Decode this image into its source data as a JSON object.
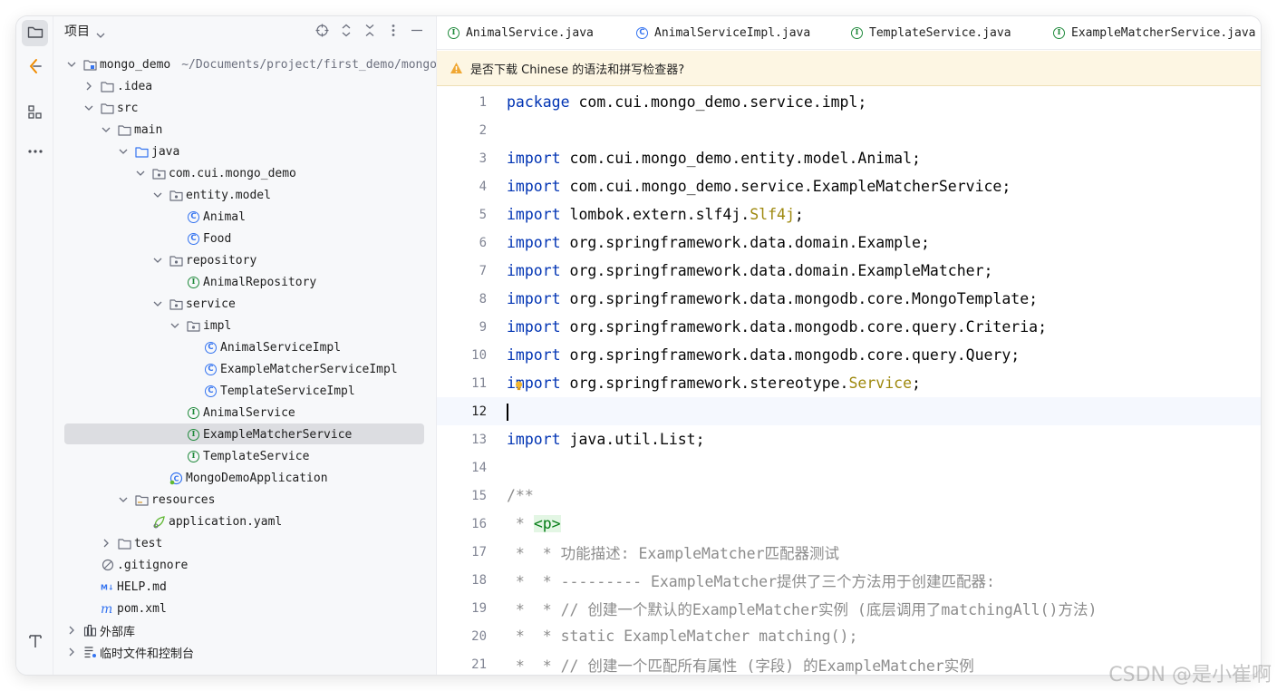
{
  "project_panel": {
    "title": "项目",
    "tree": [
      {
        "label": "mongo_demo",
        "path": "~/Documents/project/first_demo/mongo",
        "icon": "module-folder-icon",
        "expanded": true,
        "depth": 0
      },
      {
        "label": ".idea",
        "icon": "folder-icon",
        "expanded": false,
        "depth": 1
      },
      {
        "label": "src",
        "icon": "folder-icon",
        "expanded": true,
        "depth": 1
      },
      {
        "label": "main",
        "icon": "folder-icon",
        "expanded": true,
        "depth": 2
      },
      {
        "label": "java",
        "icon": "source-folder-icon",
        "expanded": true,
        "depth": 3
      },
      {
        "label": "com.cui.mongo_demo",
        "icon": "package-icon",
        "expanded": true,
        "depth": 4
      },
      {
        "label": "entity.model",
        "icon": "package-icon",
        "expanded": true,
        "depth": 5
      },
      {
        "label": "Animal",
        "icon": "class-icon",
        "depth": 6
      },
      {
        "label": "Food",
        "icon": "class-icon",
        "depth": 6
      },
      {
        "label": "repository",
        "icon": "package-icon",
        "expanded": true,
        "depth": 5
      },
      {
        "label": "AnimalRepository",
        "icon": "interface-icon",
        "depth": 6
      },
      {
        "label": "service",
        "icon": "package-icon",
        "expanded": true,
        "depth": 5
      },
      {
        "label": "impl",
        "icon": "package-icon",
        "expanded": true,
        "depth": 6
      },
      {
        "label": "AnimalServiceImpl",
        "icon": "class-icon",
        "depth": 7
      },
      {
        "label": "ExampleMatcherServiceImpl",
        "icon": "class-icon",
        "depth": 7
      },
      {
        "label": "TemplateServiceImpl",
        "icon": "class-icon",
        "depth": 7
      },
      {
        "label": "AnimalService",
        "icon": "interface-icon",
        "depth": 6
      },
      {
        "label": "ExampleMatcherService",
        "icon": "interface-icon",
        "depth": 6,
        "selected": true
      },
      {
        "label": "TemplateService",
        "icon": "interface-icon",
        "depth": 6
      },
      {
        "label": "MongoDemoApplication",
        "icon": "spring-app-icon",
        "depth": 5
      },
      {
        "label": "resources",
        "icon": "resources-folder-icon",
        "expanded": true,
        "depth": 3
      },
      {
        "label": "application.yaml",
        "icon": "yaml-icon",
        "depth": 4
      },
      {
        "label": "test",
        "icon": "folder-icon",
        "expanded": false,
        "depth": 2
      },
      {
        "label": ".gitignore",
        "icon": "ignore-icon",
        "depth": 1
      },
      {
        "label": "HELP.md",
        "icon": "markdown-icon",
        "depth": 1
      },
      {
        "label": "pom.xml",
        "icon": "maven-icon",
        "depth": 1
      },
      {
        "label": "外部库",
        "icon": "library-icon",
        "expanded": false,
        "depth": 0
      },
      {
        "label": "临时文件和控制台",
        "icon": "scratch-icon",
        "expanded": false,
        "depth": 0
      }
    ]
  },
  "tabs": [
    {
      "label": "AnimalService.java",
      "icon": "interface-icon"
    },
    {
      "label": "AnimalServiceImpl.java",
      "icon": "class-icon"
    },
    {
      "label": "TemplateService.java",
      "icon": "interface-icon"
    },
    {
      "label": "ExampleMatcherService.java",
      "icon": "interface-icon"
    }
  ],
  "banner": {
    "text": "是否下载 Chinese 的语法和拼写检查器?"
  },
  "code_lines": [
    "package com.cui.mongo_demo.service.impl;",
    "",
    "import com.cui.mongo_demo.entity.model.Animal;",
    "import com.cui.mongo_demo.service.ExampleMatcherService;",
    "import lombok.extern.slf4j.Slf4j;",
    "import org.springframework.data.domain.Example;",
    "import org.springframework.data.domain.ExampleMatcher;",
    "import org.springframework.data.mongodb.core.MongoTemplate;",
    "import org.springframework.data.mongodb.core.query.Criteria;",
    "import org.springframework.data.mongodb.core.query.Query;",
    "import org.springframework.stereotype.Service;",
    "",
    "import java.util.List;",
    "",
    "/**",
    " * <p>",
    " *  * 功能描述: ExampleMatcher匹配器测试",
    " *  * --------- ExampleMatcher提供了三个方法用于创建匹配器:",
    " *  * // 创建一个默认的ExampleMatcher实例 (底层调用了matchingAll()方法)",
    " *  * static ExampleMatcher matching();",
    " *  * // 创建一个匹配所有属性 (字段) 的ExampleMatcher实例"
  ],
  "current_line": 12,
  "watermark": "CSDN @是小崔啊",
  "colors": {
    "keyword": "#0033b3",
    "annotation": "#9e880d",
    "comment": "#8c8c8c",
    "selection": "#dcdde1",
    "banner": "#fdf6e3"
  }
}
